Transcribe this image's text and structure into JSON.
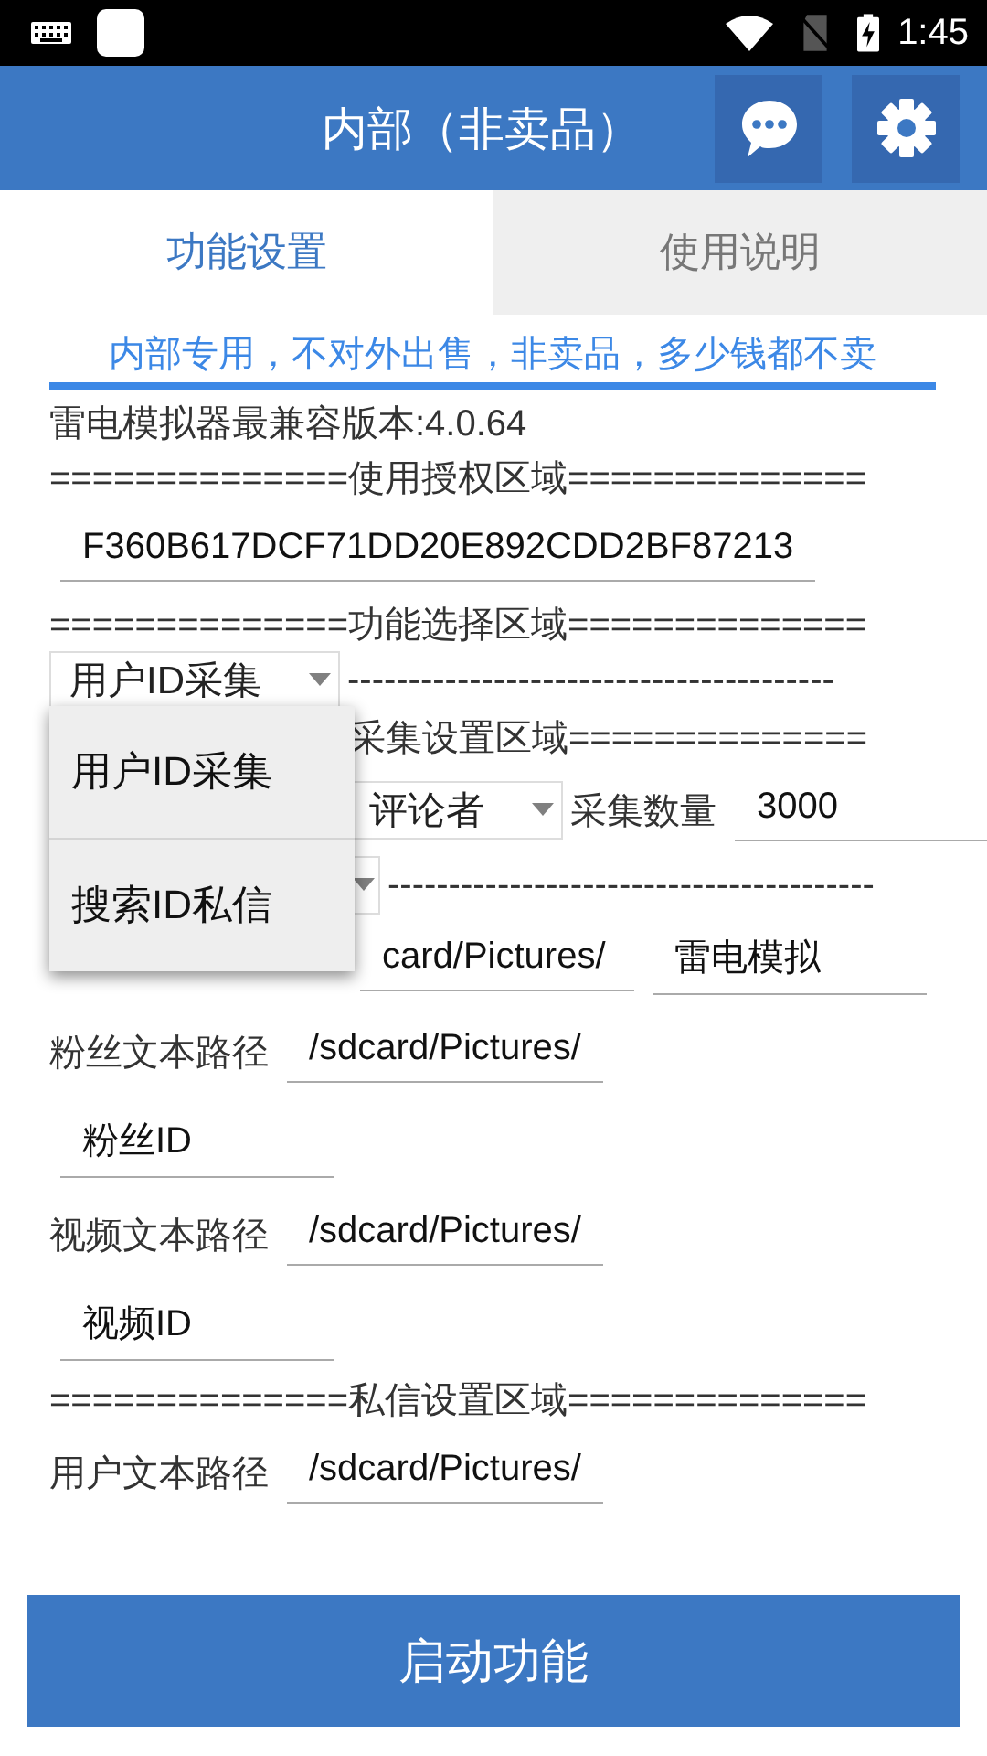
{
  "status_bar": {
    "time": "1:45"
  },
  "app_bar": {
    "title": "内部（非卖品）"
  },
  "tabs": [
    {
      "label": "功能设置",
      "selected": true
    },
    {
      "label": "使用说明",
      "selected": false
    }
  ],
  "notice": "内部专用，不对外出售，非卖品，多少钱都不卖",
  "rows": [
    {
      "under_menu": false,
      "items": [
        {
          "kind": "text",
          "text": "雷电模拟器最兼容版本:4.0.64"
        }
      ]
    },
    {
      "under_menu": false,
      "items": [
        {
          "kind": "text",
          "text": "==============使用授权区域=============="
        }
      ]
    },
    {
      "under_menu": false,
      "items": [
        {
          "kind": "field",
          "value": "F360B617DCF71DD20E892CDD2BF87213"
        }
      ]
    },
    {
      "under_menu": false,
      "items": [
        {
          "kind": "text",
          "text": "==============功能选择区域=============="
        }
      ]
    },
    {
      "under_menu": false,
      "items": [
        {
          "kind": "dropdown",
          "value": "用户ID采集"
        },
        {
          "kind": "text",
          "text": "----------------------------------------"
        }
      ]
    },
    {
      "under_menu": true,
      "items": [
        {
          "kind": "text",
          "text": "采集设置区域=============="
        }
      ]
    },
    {
      "under_menu": true,
      "items": [
        {
          "kind": "dropdown",
          "value": "评论者"
        },
        {
          "kind": "text",
          "text": "采集数量"
        },
        {
          "kind": "field",
          "value": "3000"
        }
      ]
    },
    {
      "under_menu": true,
      "items": [
        {
          "kind": "dropdown"
        },
        {
          "kind": "text",
          "text": "----------------------------------------"
        }
      ]
    },
    {
      "under_menu": true,
      "items": [
        {
          "kind": "field",
          "value": "card/Pictures/"
        },
        {
          "kind": "field",
          "value": "雷电模拟"
        }
      ]
    },
    {
      "under_menu": false,
      "items": [
        {
          "kind": "text",
          "text": "粉丝文本路径"
        },
        {
          "kind": "field",
          "value": "/sdcard/Pictures/"
        }
      ]
    },
    {
      "under_menu": false,
      "items": [
        {
          "kind": "field",
          "value": "粉丝ID"
        }
      ]
    },
    {
      "under_menu": false,
      "items": [
        {
          "kind": "text",
          "text": "视频文本路径"
        },
        {
          "kind": "field",
          "value": "/sdcard/Pictures/"
        }
      ]
    },
    {
      "under_menu": false,
      "items": [
        {
          "kind": "field",
          "value": "视频ID"
        }
      ]
    },
    {
      "under_menu": false,
      "items": [
        {
          "kind": "text",
          "text": "==============私信设置区域=============="
        }
      ]
    },
    {
      "under_menu": false,
      "items": [
        {
          "kind": "text",
          "text": "用户文本路径"
        },
        {
          "kind": "field",
          "value": "/sdcard/Pictures/"
        }
      ]
    }
  ],
  "menu": {
    "items": [
      {
        "label": "用户ID采集"
      },
      {
        "label": "搜索ID私信"
      }
    ]
  },
  "action_button": {
    "label": "启动功能"
  }
}
